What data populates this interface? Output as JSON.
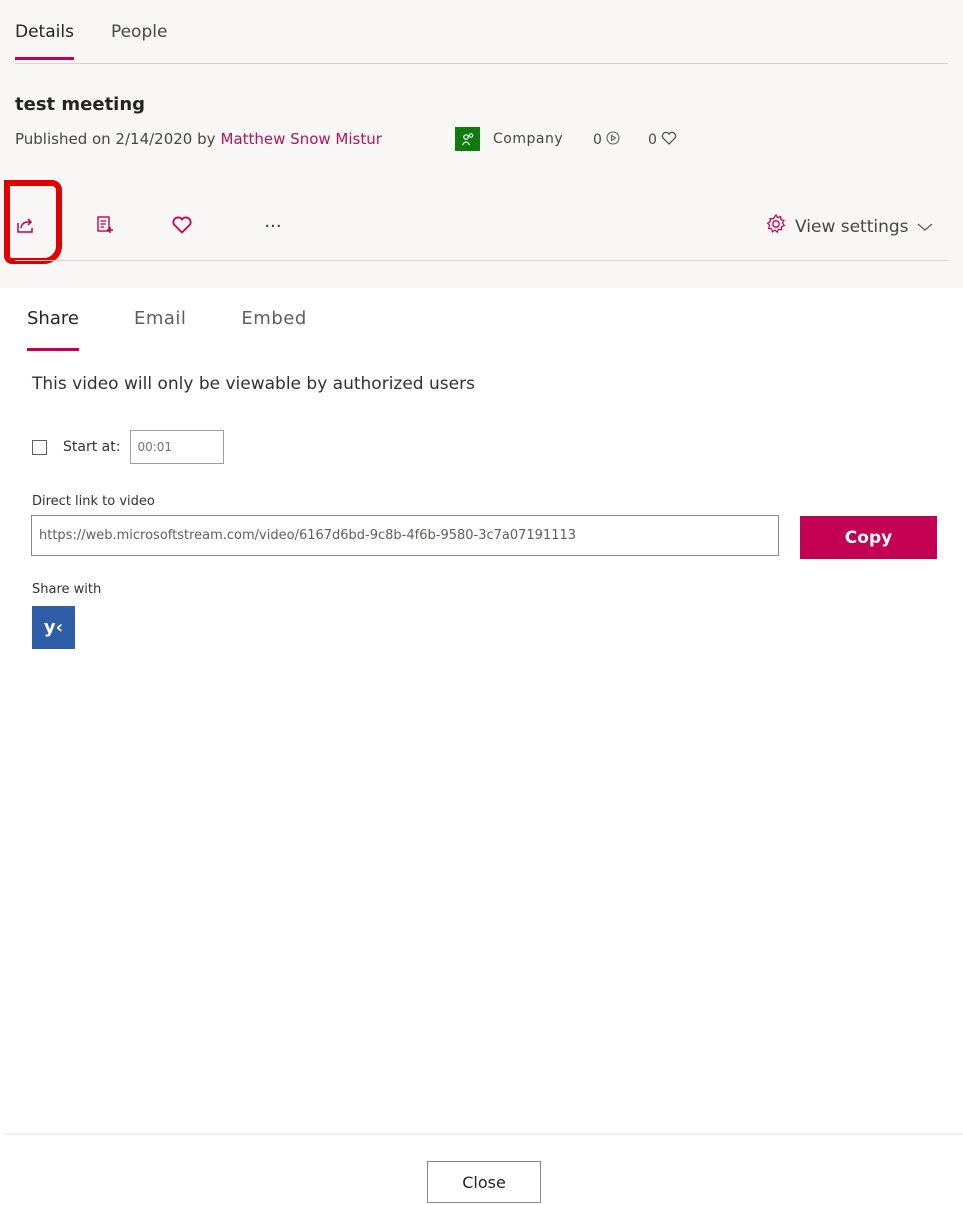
{
  "tabs": [
    {
      "label": "Details"
    },
    {
      "label": "People"
    }
  ],
  "video": {
    "title": "test meeting",
    "published_prefix": "Published on 2/14/2020 by",
    "author": "Matthew Snow Mistur",
    "permission": "Company",
    "views": "0",
    "likes": "0"
  },
  "actions": {
    "more_label": "···",
    "view_settings_label": "View settings"
  },
  "share_tabs": [
    {
      "label": "Share"
    },
    {
      "label": "Email"
    },
    {
      "label": "Embed"
    }
  ],
  "share": {
    "notice": "This video will only be viewable by authorized users",
    "start_at_label": "Start at:",
    "start_at_placeholder": "00:01",
    "start_at_checked": false,
    "direct_link_label": "Direct link to video",
    "direct_link_value": "https://web.microsoftstream.com/video/6167d6bd-9c8b-4f6b-9580-3c7a07191113",
    "copy_label": "Copy",
    "share_with_label": "Share with",
    "yammer_glyph": "y‹"
  },
  "footer": {
    "close_label": "Close"
  },
  "colors": {
    "accent": "#c30052",
    "author": "#b4145a",
    "company_icon": "#107c10",
    "yammer": "#2f5ea8",
    "highlight": "#e00000"
  }
}
